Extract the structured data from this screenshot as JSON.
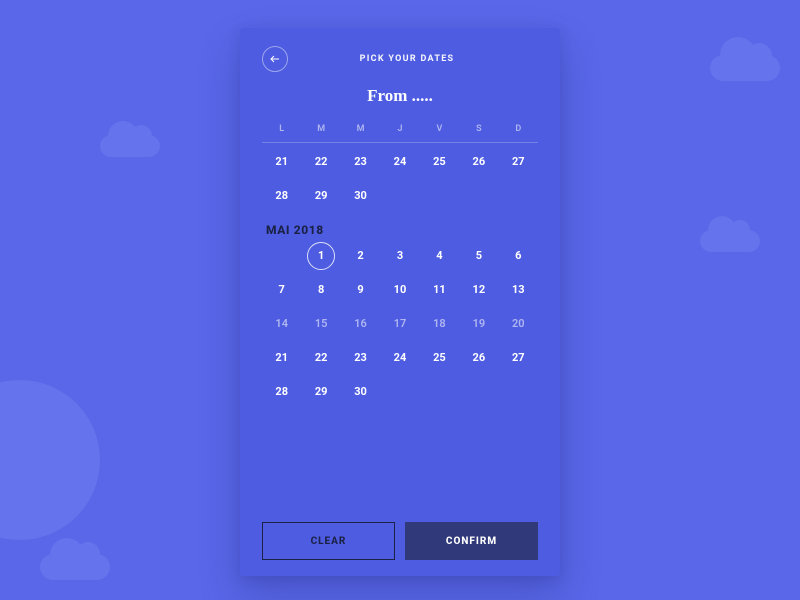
{
  "header": {
    "title": "PICK YOUR DATES"
  },
  "range_label": "From .....",
  "day_of_week_labels": [
    "L",
    "M",
    "M",
    "J",
    "V",
    "S",
    "D"
  ],
  "prev_month_tail_weeks": [
    [
      21,
      22,
      23,
      24,
      25,
      26,
      27
    ],
    [
      28,
      29,
      30,
      null,
      null,
      null,
      null
    ]
  ],
  "month": {
    "label": "MAI 2018"
  },
  "month_weeks": [
    [
      null,
      1,
      2,
      3,
      4,
      5,
      6
    ],
    [
      7,
      8,
      9,
      10,
      11,
      12,
      13
    ],
    [
      14,
      15,
      16,
      17,
      18,
      19,
      20
    ],
    [
      21,
      22,
      23,
      24,
      25,
      26,
      27
    ],
    [
      28,
      29,
      30,
      null,
      null,
      null,
      null
    ]
  ],
  "selected_day": 1,
  "actions": {
    "clear": "CLEAR",
    "confirm": "CONFIRM"
  }
}
